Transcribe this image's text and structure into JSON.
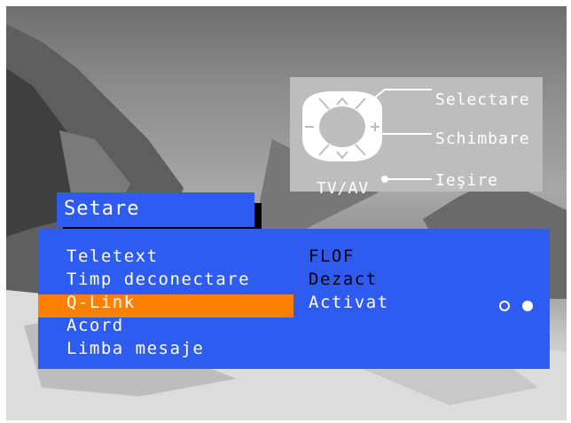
{
  "help": {
    "select": "Selectare",
    "change": "Schimbare",
    "exit": "Ieşire",
    "tvav": "TV/AV"
  },
  "menu": {
    "title": "Setare",
    "items": [
      {
        "label": "Teletext"
      },
      {
        "label": "Timp deconectare"
      },
      {
        "label": "Q-Link",
        "selected": true
      },
      {
        "label": "Acord"
      },
      {
        "label": "Limba mesaje"
      }
    ],
    "values": [
      "FLOF",
      "Dezact",
      "Activat"
    ],
    "option_count": 2,
    "option_selected_index": 1
  },
  "colors": {
    "menu_blue": "#2f5cf0",
    "highlight_orange": "#ff7f00",
    "help_gray": "#bdbdbd"
  }
}
